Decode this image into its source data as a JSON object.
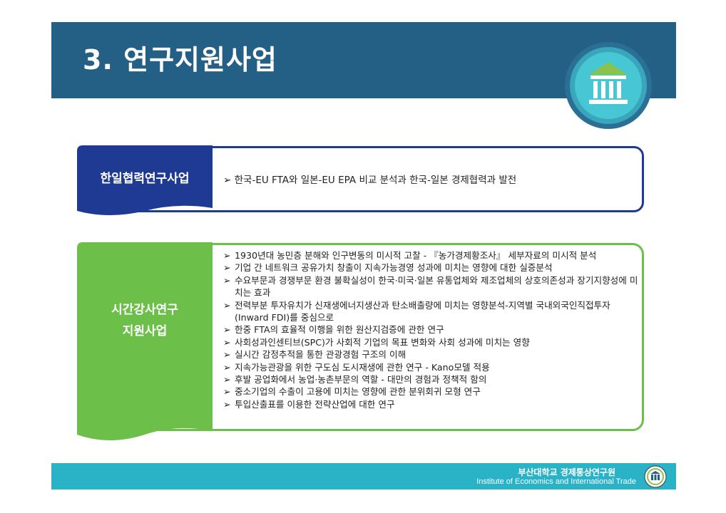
{
  "header": {
    "title": "3. 연구지원사업"
  },
  "sections": [
    {
      "tag": "한일협력연구사업",
      "items": [
        "한국-EU FTA와 일본-EU EPA 비교 분석과 한국-일본 경제협력과 발전"
      ]
    },
    {
      "tag_line1": "시간강사연구",
      "tag_line2": "지원사업",
      "items": [
        "1930년대 농민층 분해와 인구변동의 미시적 고찰 - 『농가경제황조사』 세부자료의 미시적 분석",
        "기업 간 네트워크 공유가치 창출이 지속가능경영 성과에 미치는 영향에 대한 실증분석",
        "수요부문과 경쟁부문 환경 불확실성이 한국·미국·일본 유통업체와 제조업체의 상호의존성과 장기지향성에 미치는 효과",
        "전력부분 투자유치가 신재생에너지생산과 탄소배출량에 미치는 영향분석-지역별 국내외국인직접투자(Inward FDI)를 중심으로",
        "한중 FTA의 효율적 이행을 위한 원산지검증에 관한 연구",
        "사회성과인센티브(SPC)가 사회적 기업의 목표 변화와 사회 성과에 미치는 영향",
        "실시간 감정추적을 통한 관광경험 구조의 이해",
        "지속가능관광을 위한 구도심 도시재생에 관한 연구 - Kano모델 적용",
        "후발 공업화에서 농업·농촌부문의 역할 - 대만의 경험과 정책적 함의",
        "중소기업의 수출이 고용에 미치는 영향에 관한 분위회귀 모형 연구",
        "투입산출표를 이용한 전략산업에 대한 연구"
      ]
    }
  ],
  "footer": {
    "korean": "부산대학교 경제통상연구원",
    "english": "Institute of Economics and International Trade"
  },
  "bullet": "➢",
  "colors": {
    "header": "#245f86",
    "tag1": "#1f3a93",
    "tag2": "#6cc04a",
    "footer": "#2ab2c7"
  }
}
